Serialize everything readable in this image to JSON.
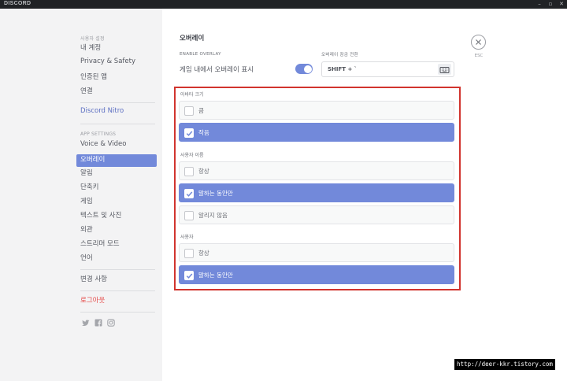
{
  "window": {
    "app_name": "DISCORD"
  },
  "sidebar": {
    "user_settings_header": "사용자 설정",
    "user_items": [
      "내 계정",
      "Privacy & Safety",
      "인증된 앱",
      "연결"
    ],
    "nitro": "Discord Nitro",
    "app_settings_header": "APP SETTINGS",
    "app_items": [
      "Voice & Video",
      "오버레이",
      "알림",
      "단축키",
      "게임",
      "텍스트 및 사진",
      "외관",
      "스트리머 모드",
      "언어"
    ],
    "active_item": "오버레이",
    "changelog": "변경 사항",
    "logout": "로그아웃"
  },
  "main": {
    "title": "오버레이",
    "enable_overlay_label": "ENABLE OVERLAY",
    "show_ingame_label": "게임 내에서 오버레이 표시",
    "toggle_state": "on",
    "lock_label": "오버레이 잠금 전환",
    "lock_key": "SHIFT + `",
    "close_label": "ESC",
    "avatar_size": {
      "label": "아바타 크기",
      "options": [
        {
          "label": "큼",
          "checked": false
        },
        {
          "label": "작음",
          "checked": true
        }
      ]
    },
    "display_names": {
      "label": "사용자 이름",
      "options": [
        {
          "label": "항상",
          "checked": false
        },
        {
          "label": "말하는 동안만",
          "checked": true
        },
        {
          "label": "알리지 않음",
          "checked": false
        }
      ]
    },
    "display_users": {
      "label": "사용자",
      "options": [
        {
          "label": "항상",
          "checked": false
        },
        {
          "label": "말하는 동안만",
          "checked": true
        }
      ]
    }
  },
  "watermark": "http://deer-kkr.tistory.com",
  "colors": {
    "accent": "#7289da",
    "highlight_border": "#d1342e",
    "logout": "#e64a48"
  }
}
